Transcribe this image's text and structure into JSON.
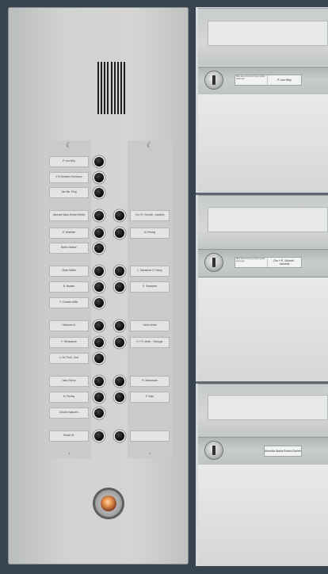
{
  "intercom": {
    "left_column_labels": [
      "P. von Wiry",
      "K+E Bohlsen Fehlhaver",
      "Van Ms. Perg",
      "Almeida Maria Robert Dieleh",
      "H. Woeltner",
      "Brehn Helene",
      "Oliver Müller",
      "B. Brande",
      "F. Crasser-Aiffer",
      "Hofmann M.",
      "F. Obrisschek",
      "L./ M. Proß - Kurt",
      "Hans Tierny",
      "M. Pirning",
      "Simone Mannert",
      "Rosch W."
    ],
    "right_column_labels": [
      "Chr.+R. Schnell - Jakobitz",
      "M. Pirning",
      "L. Schweizer S. Horny",
      "S. Glandorte",
      "Gerlin Arntzl",
      "H.+ R. Meier - Geringer",
      "P. Leitermeder",
      "F. Nold",
      ""
    ],
    "moon_symbols": [
      "☾",
      "☾"
    ],
    "bottom_marks": [
      "1",
      "1"
    ]
  },
  "mailboxes": [
    {
      "tiny_text": "Bitte keine Werbung Keine gratis Zeitungen",
      "name": "P. von Wiry"
    },
    {
      "tiny_text": "Bitte keine Werbung Keine gratis Zeitungen",
      "name": "Chr.+ R. Schnell - Jakobitz"
    },
    {
      "tiny_text": "",
      "name": "Almeida Maria Robert Dieleh"
    }
  ],
  "colors": {
    "background": "#37434e",
    "panel": "#d1d3d1",
    "bell_light": "#e79552"
  }
}
